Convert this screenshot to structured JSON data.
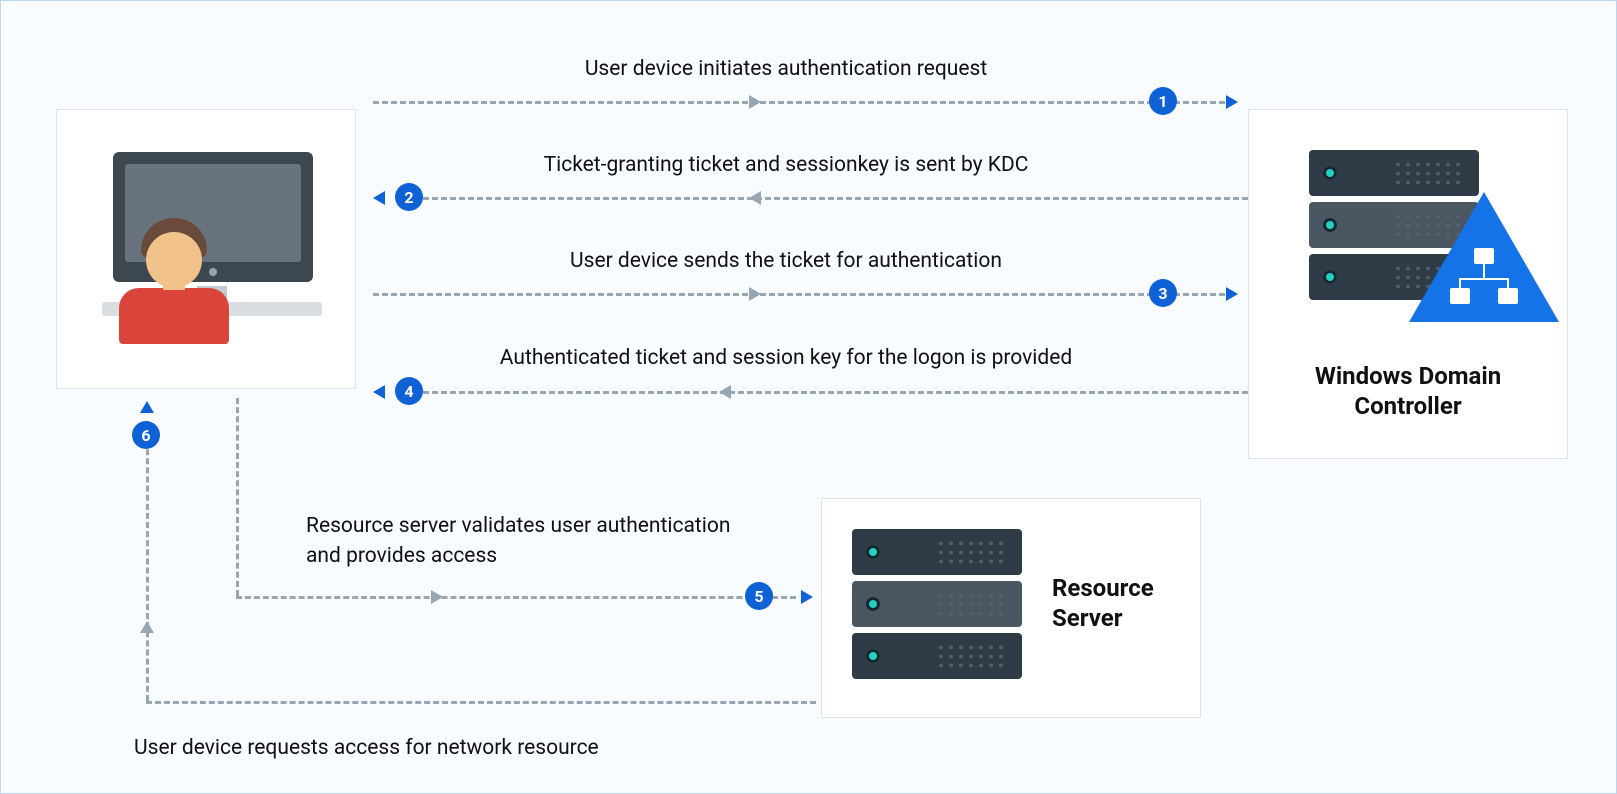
{
  "nodes": {
    "user": {
      "alt": "User device"
    },
    "dc": {
      "title_line1": "Windows Domain",
      "title_line2": "Controller"
    },
    "rs": {
      "title_line1": "Resource",
      "title_line2": "Server"
    }
  },
  "steps": {
    "s1": {
      "num": "1",
      "text": "User device initiates authentication request"
    },
    "s2": {
      "num": "2",
      "text": "Ticket-granting ticket and sessionkey is sent by KDC"
    },
    "s3": {
      "num": "3",
      "text": "User device sends the ticket for authentication"
    },
    "s4": {
      "num": "4",
      "text": "Authenticated ticket and session key for the logon is provided"
    },
    "s5": {
      "num": "5",
      "text": "Resource server validates user authentication and provides access"
    },
    "s6": {
      "num": "6",
      "text": "User device requests access for network resource"
    }
  }
}
